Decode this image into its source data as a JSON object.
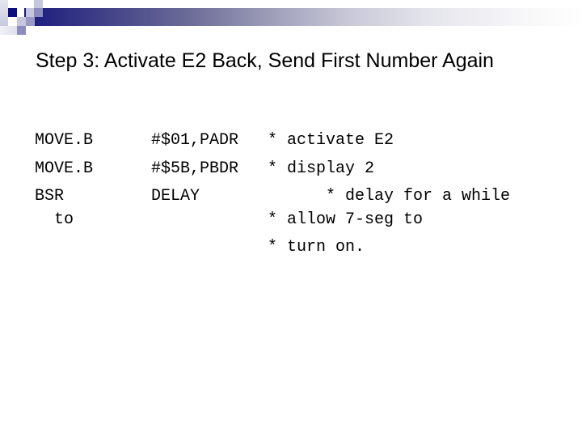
{
  "slide": {
    "title": "Step 3: Activate E2 Back, Send First Number Again",
    "code_lines": [
      {
        "mnemonic": "MOVE.B",
        "operand": "#$01,PADR",
        "comment": "* activate E2"
      },
      {
        "mnemonic": "MOVE.B",
        "operand": "#$5B,PBDR",
        "comment": "* display 2"
      },
      {
        "mnemonic": "BSR",
        "operand": "DELAY",
        "comment": "* delay for a while"
      },
      {
        "mnemonic": "to",
        "operand": "",
        "comment": "* allow 7-seg to"
      },
      {
        "mnemonic": "",
        "operand": "",
        "comment": "* turn on."
      }
    ]
  },
  "theme": {
    "accent": "#1a1a80",
    "accent_light": "#c6c6de",
    "text": "#000000",
    "background": "#ffffff"
  }
}
